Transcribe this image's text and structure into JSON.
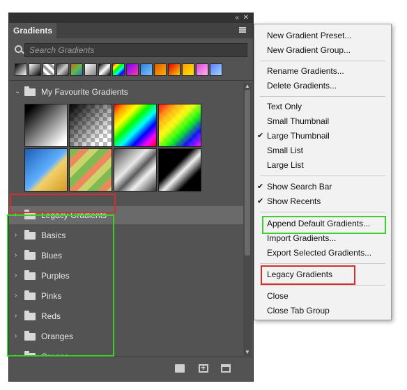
{
  "panel": {
    "tab_title": "Gradients",
    "search_placeholder": "Search Gradients",
    "groups": {
      "favourites": "My Favourite Gradients",
      "legacy": "Legacy Gradients",
      "basics": "Basics",
      "blues": "Blues",
      "purples": "Purples",
      "pinks": "Pinks",
      "reds": "Reds",
      "oranges": "Oranges",
      "greens": "Greens"
    }
  },
  "context_menu": {
    "items": [
      {
        "label": "New Gradient Preset...",
        "checked": false
      },
      {
        "label": "New Gradient Group...",
        "checked": false
      },
      {
        "label": "Rename Gradients...",
        "checked": false
      },
      {
        "label": "Delete Gradients...",
        "checked": false
      },
      {
        "label": "Text Only",
        "checked": false
      },
      {
        "label": "Small Thumbnail",
        "checked": false
      },
      {
        "label": "Large Thumbnail",
        "checked": true
      },
      {
        "label": "Small List",
        "checked": false
      },
      {
        "label": "Large List",
        "checked": false
      },
      {
        "label": "Show Search Bar",
        "checked": true
      },
      {
        "label": "Show Recents",
        "checked": true
      },
      {
        "label": "Append Default Gradients...",
        "checked": false
      },
      {
        "label": "Import Gradients...",
        "checked": false
      },
      {
        "label": "Export Selected Gradients...",
        "checked": false
      },
      {
        "label": "Legacy Gradients",
        "checked": false
      },
      {
        "label": "Close",
        "checked": false
      },
      {
        "label": "Close Tab Group",
        "checked": false
      }
    ]
  },
  "icons": {
    "menu": "hamburger-menu-icon",
    "collapse": "double-chevron-icon",
    "close": "close-icon",
    "search": "search-icon",
    "folder": "folder-icon",
    "new": "new-gradient-icon",
    "trash": "trash-icon"
  },
  "colors": {
    "panel_bg": "#535353",
    "menu_bg": "#f2f2f2",
    "red_highlight": "#d32f2f",
    "green_highlight": "#3ad12a"
  }
}
